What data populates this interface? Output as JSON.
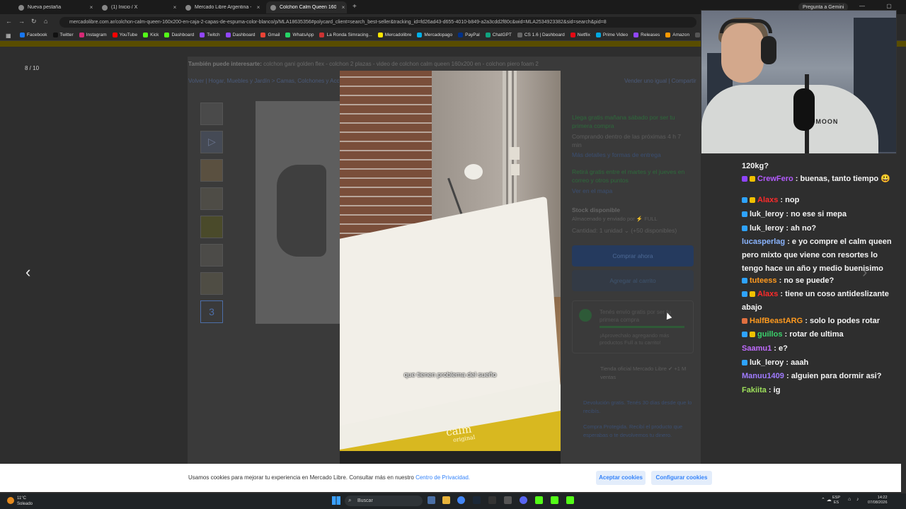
{
  "browser": {
    "tabs": [
      {
        "title": "Nueva pestaña",
        "active": false
      },
      {
        "title": "(1) Inicio / X",
        "active": false
      },
      {
        "title": "Mercado Libre Argentina - Env",
        "active": false
      },
      {
        "title": "Colchon Calm Queen 160x",
        "active": true
      }
    ],
    "new_tab": "+",
    "gemini_button": "Pregunta a Gemini",
    "window_controls": "— ▢ ✕",
    "url": "mercadolibre.com.ar/colchon-calm-queen-160x200-en-caja-2-capas-de-espuma-color-blanco/p/MLA18635356#polycard_client=search_best-seller&tracking_id=fd26ad43-d655-4010-b849-a2a3cdd2f80c&wid=MLA2534923382&sid=search&pid=8",
    "bookmarks": [
      "Facebook",
      "Twitter",
      "Instagram",
      "YouTube",
      "Kick",
      "Dashboard",
      "Twitch",
      "Dashboard",
      "Gmail",
      "WhatsApp",
      "La Ronda Simracing...",
      "Mercadolibre",
      "Mercadopago",
      "PayPal",
      "ChatGPT",
      "CS 1.6 | Dashboard",
      "Netflix",
      "Prime Video",
      "Releases",
      "Amazon",
      "JUAN TURR"
    ],
    "bookmark_colors": [
      "#1877f2",
      "#111111",
      "#d62976",
      "#ff0000",
      "#53fc18",
      "#53fc18",
      "#9146ff",
      "#9146ff",
      "#ea4335",
      "#25d366",
      "#cc3333",
      "#ffe600",
      "#00b1ea",
      "#003087",
      "#10a37f",
      "#666666",
      "#e50914",
      "#00a8e1",
      "#9146ff",
      "#ff9900",
      "#555555"
    ]
  },
  "page": {
    "counter": "8 / 10",
    "also_label": "También puede interesarte:",
    "also_items": "colchon gani golden flex - colchon 2 plazas - video de colchon calm queen 160x200 en - colchon piero foam 2",
    "breadcrumb": "Volver   |   Hogar, Muebles y Jardín  >  Camas, Colchones y Acc.",
    "breadcrumb_right": "Vender uno igual   |   Compartir",
    "thumb_selected": "3",
    "shipping_free": "Llega gratis mañana sábado por ser tu primera compra",
    "shipping_time": "Comprando dentro de las próximas 4 h 7 min",
    "shipping_more": "Más detalles y formas de entrega",
    "pickup": "Retirá gratis entre el martes y el jueves en correo y otros puntos",
    "pickup_map": "Ver en el mapa",
    "stock": "Stock disponible",
    "stored": "Almacenado y enviado por ⚡ FULL",
    "quantity": "Cantidad: 1 unidad  ⌄ (+50 disponibles)",
    "buy_now": "Comprar ahora",
    "add_cart": "Agregar al carrito",
    "ship_box_title": "Tenés envío gratis por ser tu primera compra",
    "ship_box_sub": "¡Aprovechalo agregando más productos Full a tu carrito!",
    "seller": "Tienda oficial Mercado Libre ✔ +1 M ventas",
    "returns": "Devolución gratis. Tenés 30 días desde que lo recibís.",
    "protected": "Compra Protegida. Recibí el producto que esperabas o te devolvemos tu dinero."
  },
  "video": {
    "caption": "que tienen problema del sueño",
    "brand": "calm",
    "brand_sub": "original"
  },
  "webcam": {
    "shirt_text": "STOMOON"
  },
  "chat": [
    {
      "user": "",
      "color": "#ffffff",
      "badges": [],
      "text": "120kg?"
    },
    {
      "user": "CrewFero",
      "color": "#b45bff",
      "badges": [
        "#8e44ff",
        "#f0c000"
      ],
      "text": "buenas, tanto tiempo 😃"
    },
    {
      "user": "Alaxs",
      "color": "#ff2a2a",
      "badges": [
        "#2ea3ff",
        "#f0c000"
      ],
      "text": "nop"
    },
    {
      "user": "luk_leroy",
      "color": "#f2f2f2",
      "badges": [
        "#2ea3ff"
      ],
      "text": "no ese si mepa"
    },
    {
      "user": "luk_leroy",
      "color": "#f2f2f2",
      "badges": [
        "#2ea3ff"
      ],
      "text": "ah no?"
    },
    {
      "user": "lucasperlag",
      "color": "#8ab4ff",
      "badges": [],
      "text": "e yo compre el calm queen pero mixto que viene con resortes lo tengo hace un año y medio buenisimo"
    },
    {
      "user": "tuteess",
      "color": "#ff9a1f",
      "badges": [
        "#2ea3ff"
      ],
      "text": "no se puede?"
    },
    {
      "user": "Alaxs",
      "color": "#ff2a2a",
      "badges": [
        "#2ea3ff",
        "#f0c000"
      ],
      "text": "tiene un coso antideslizante abajo"
    },
    {
      "user": "HalfBeastARG",
      "color": "#ff9a1f",
      "badges": [
        "#e07040"
      ],
      "text": "solo lo podes rotar"
    },
    {
      "user": "guillos",
      "color": "#3ad16b",
      "badges": [
        "#2ea3ff",
        "#f0c000"
      ],
      "text": "rotar de ultima"
    },
    {
      "user": "Saamu1",
      "color": "#c06bff",
      "badges": [],
      "text": "e?"
    },
    {
      "user": "luk_leroy",
      "color": "#f2f2f2",
      "badges": [
        "#2ea3ff"
      ],
      "text": "aaah"
    },
    {
      "user": "Manuu1409",
      "color": "#a07bff",
      "badges": [],
      "text": "alguien para dormir asi?"
    },
    {
      "user": "Fakiita",
      "color": "#9de05b",
      "badges": [],
      "text": "ig"
    }
  ],
  "cookie": {
    "text": "Usamos cookies para mejorar tu experiencia en Mercado Libre. Consultar más en nuestro",
    "link": "Centro de Privacidad.",
    "accept": "Aceptar cookies",
    "configure": "Configurar cookies"
  },
  "taskbar": {
    "weather_temp": "11°C",
    "weather_desc": "Soleado",
    "search": "Buscar",
    "tray": "⌃  ☁",
    "lang_1": "ESP",
    "lang_2": "ES",
    "time": "14:22",
    "date": "07/08/2026"
  }
}
